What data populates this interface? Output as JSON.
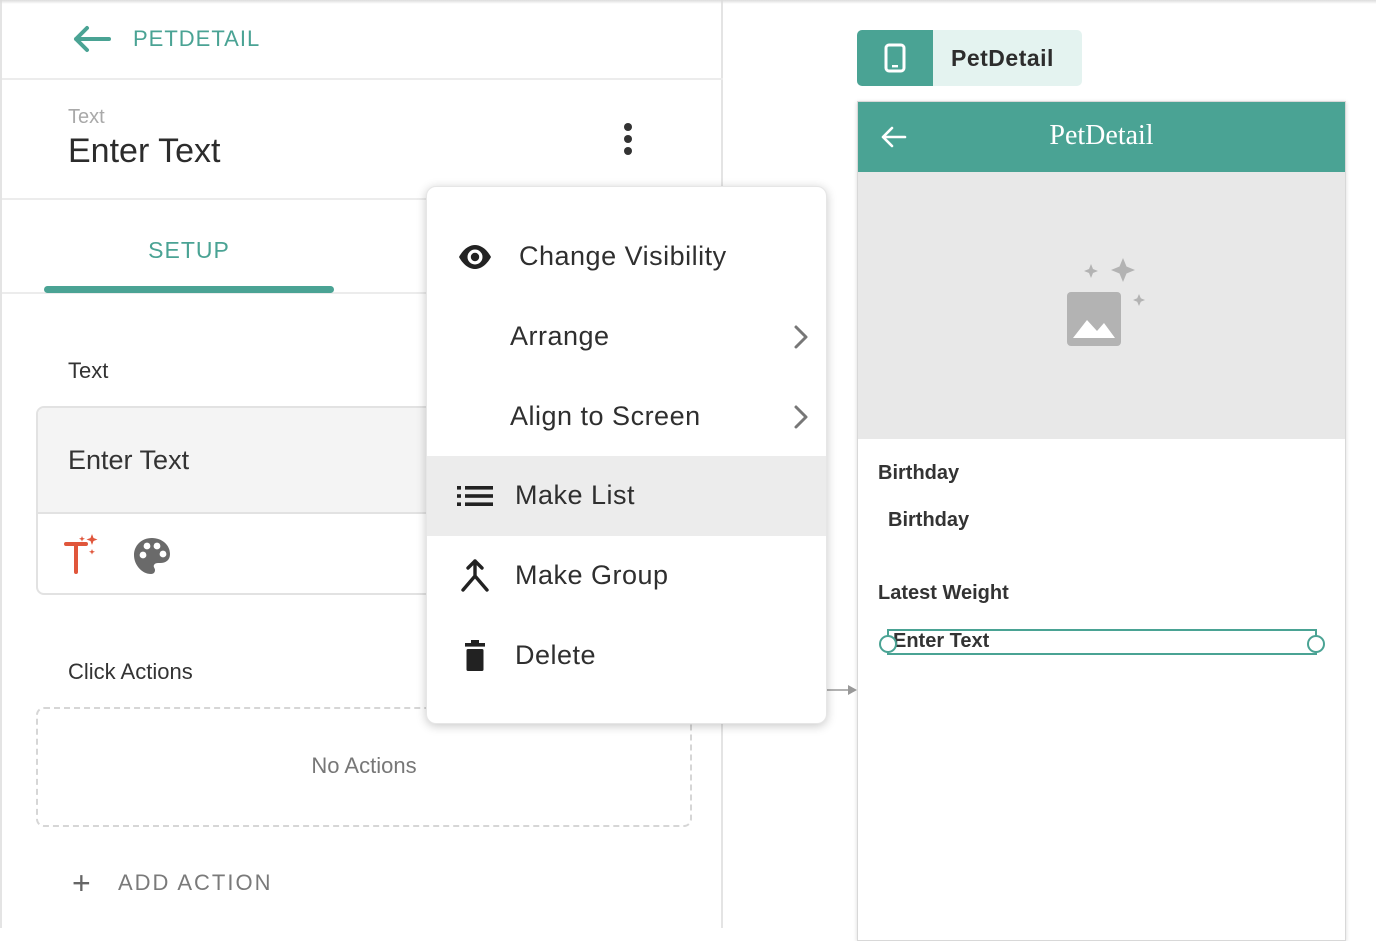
{
  "header": {
    "back_label": "PETDETAIL"
  },
  "component": {
    "type_label": "Text",
    "name": "Enter Text"
  },
  "tabs": [
    {
      "label": "SETUP",
      "active": true
    }
  ],
  "text_section": {
    "label": "Text",
    "value": "Enter Text"
  },
  "click_actions": {
    "label": "Click Actions",
    "empty_text": "No Actions",
    "add_label": "ADD ACTION"
  },
  "menu": {
    "items": [
      {
        "label": "Change Visibility",
        "icon": "eye-icon"
      },
      {
        "label": "Arrange",
        "icon": "chevron-right-icon"
      },
      {
        "label": "Align to Screen",
        "icon": "chevron-right-icon"
      },
      {
        "label": "Make List",
        "icon": "list-icon",
        "highlighted": true
      },
      {
        "label": "Make Group",
        "icon": "merge-icon"
      },
      {
        "label": "Delete",
        "icon": "trash-icon"
      }
    ]
  },
  "canvas": {
    "page_tag": "PetDetail",
    "app_bar_title": "PetDetail",
    "fields": [
      {
        "label": "Birthday",
        "value": "Birthday"
      },
      {
        "label": "Latest Weight",
        "value": "Enter Text"
      }
    ]
  },
  "colors": {
    "accent": "#4aa394",
    "menu_highlight": "#ececec",
    "image_placeholder": "#e8e8e8"
  }
}
